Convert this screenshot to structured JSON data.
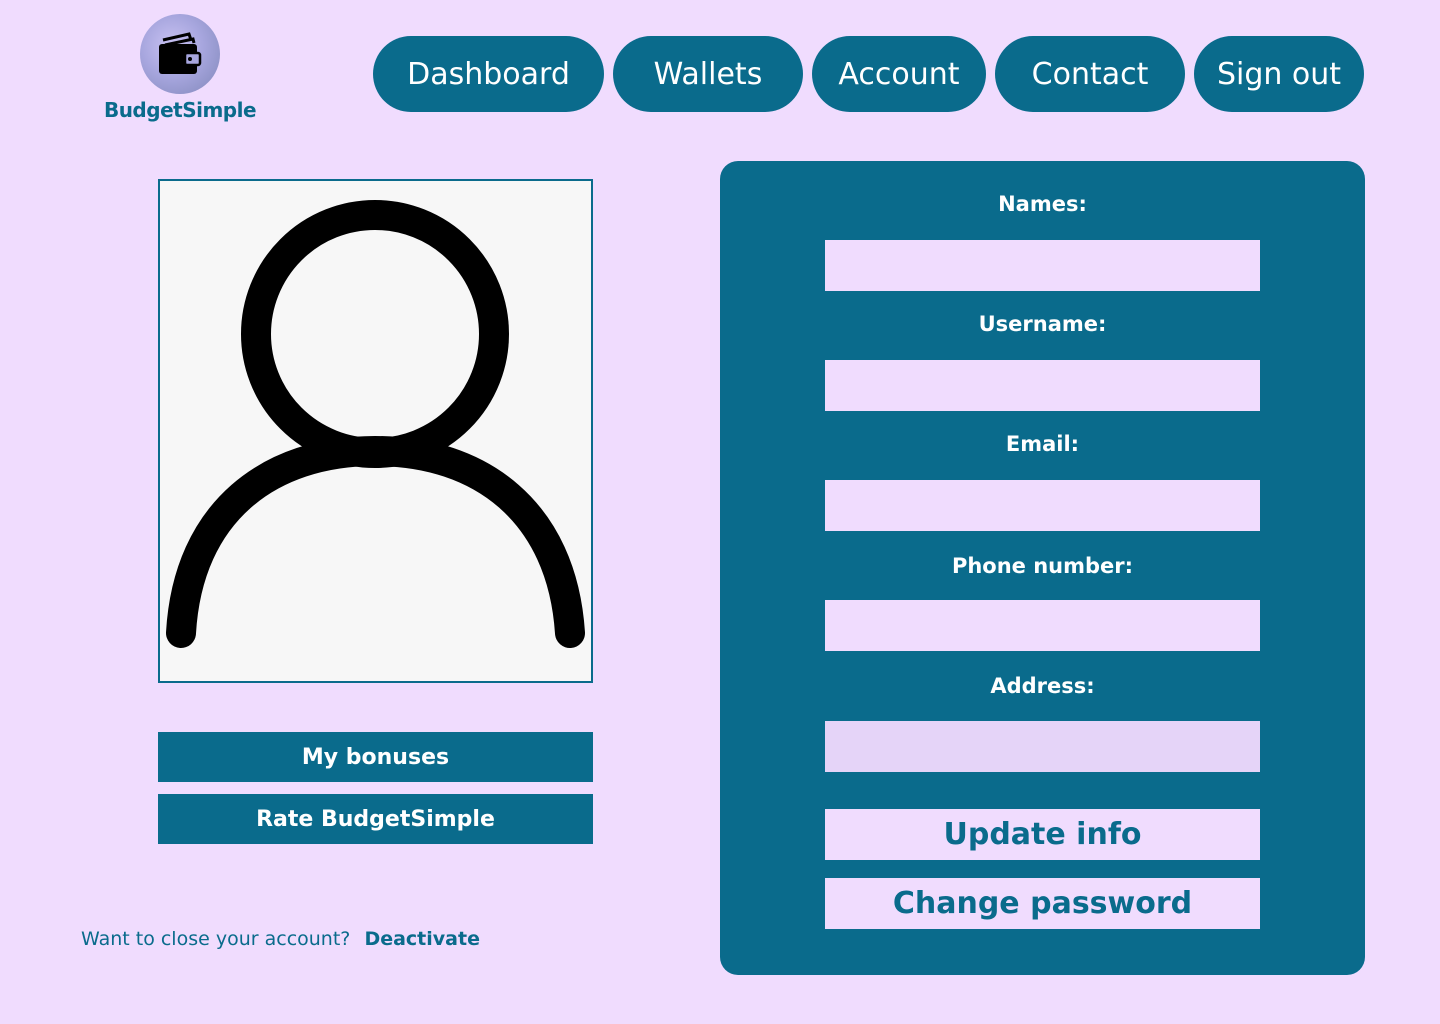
{
  "brand": {
    "name": "BudgetSimple",
    "logo_icon": "wallet-icon"
  },
  "nav": {
    "items": [
      {
        "label": "Dashboard"
      },
      {
        "label": "Wallets"
      },
      {
        "label": "Account"
      },
      {
        "label": "Contact"
      },
      {
        "label": "Sign out"
      }
    ]
  },
  "profile": {
    "avatar_icon": "user-icon",
    "bonuses_label": "My bonuses",
    "rate_label": "Rate BudgetSimple",
    "close_prompt": "Want to close your account?",
    "deactivate_label": "Deactivate"
  },
  "form": {
    "fields": [
      {
        "label": "Names:",
        "value": ""
      },
      {
        "label": "Username:",
        "value": ""
      },
      {
        "label": "Email:",
        "value": ""
      },
      {
        "label": "Phone number:",
        "value": ""
      },
      {
        "label": "Address:",
        "value": ""
      }
    ],
    "update_label": "Update info",
    "password_label": "Change password"
  },
  "colors": {
    "background": "#f0dcfe",
    "primary": "#0a6b8c",
    "input": "#f0dcfe",
    "avatar_bg": "#f7f7f7"
  }
}
